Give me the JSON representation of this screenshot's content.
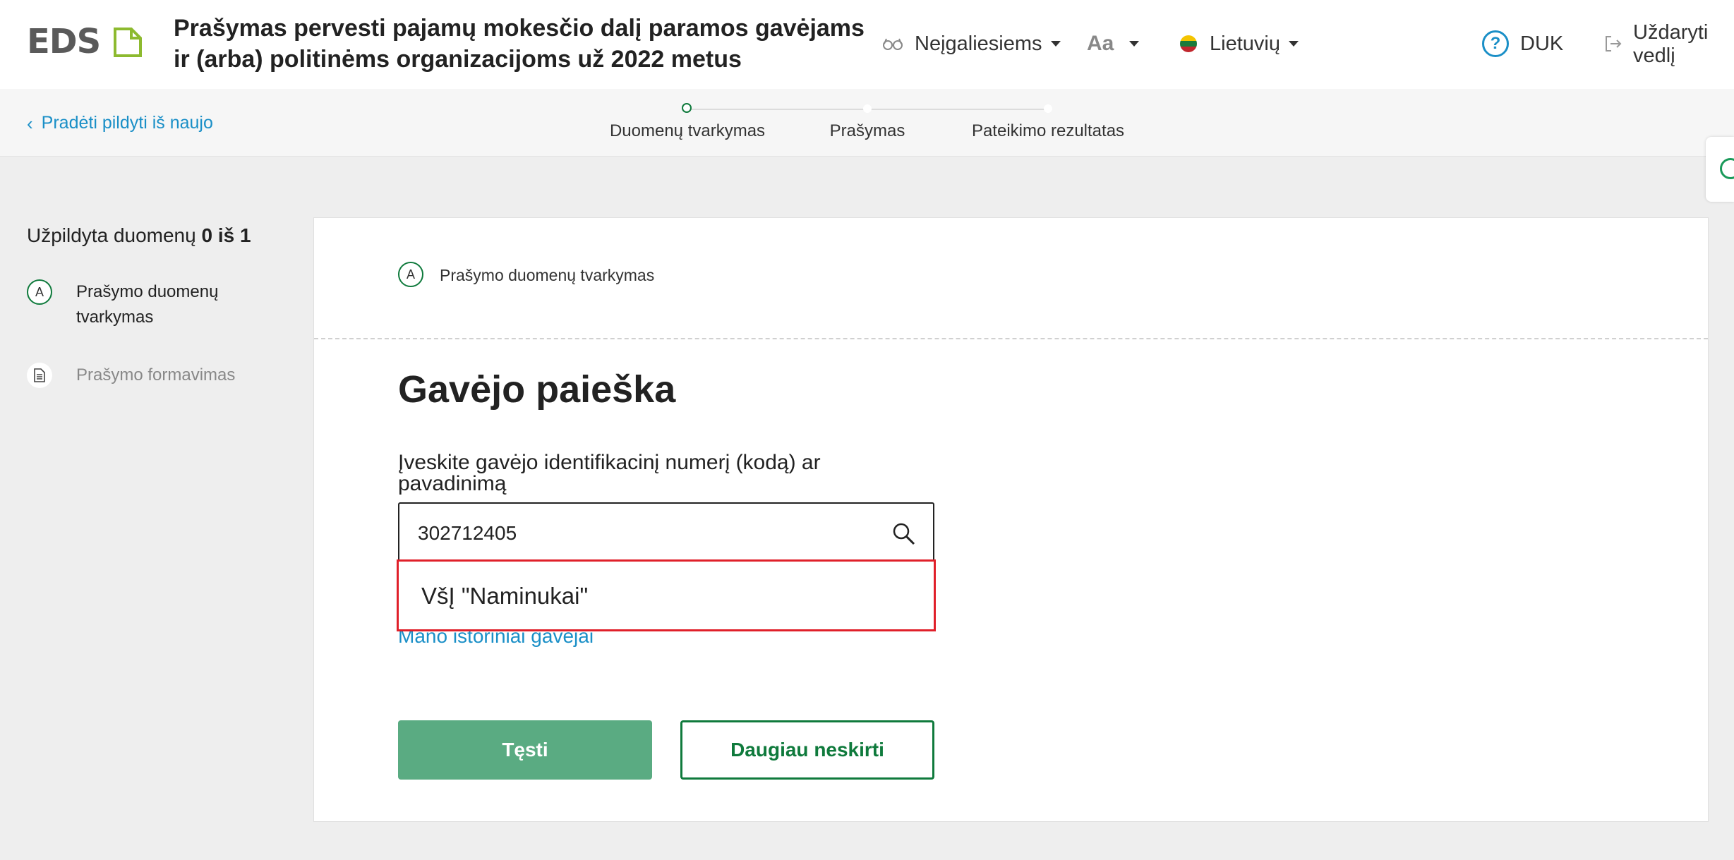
{
  "header": {
    "logo": "EDS",
    "title": "Prašymas pervesti pajamų mokesčio dalį paramos gavėjams ir (arba) politinėms organizacijoms už 2022 metus",
    "accessibility_label": "Neįgaliesiems",
    "font_size_label": "Aa",
    "language_label": "Lietuvių",
    "faq_label": "DUK",
    "close_label": "Uždaryti vedlį"
  },
  "stepbar": {
    "back_label": "Pradėti pildyti iš naujo",
    "steps": [
      {
        "label": "Duomenų tvarkymas",
        "active": true
      },
      {
        "label": "Prašymas",
        "active": false
      },
      {
        "label": "Pateikimo rezultatas",
        "active": false
      }
    ]
  },
  "progress": {
    "title_prefix": "Užpildyta duomenų",
    "count": "0 iš 1",
    "sections": [
      {
        "badge": "A",
        "label": "Prašymo duomenų tvarkymas"
      },
      {
        "label": "Prašymo formavimas"
      }
    ]
  },
  "card": {
    "section_badge": "A",
    "section_label": "Prašymo duomenų tvarkymas",
    "heading": "Gavėjo paieška",
    "field_label": "Įveskite gavėjo identifikacinį numerį (kodą) ar pavadinimą",
    "search_value": "302712405",
    "history_link": "Mano istoriniai gavėjai",
    "suggestion": "VšĮ \"Naminukai\"",
    "continue_label": "Tęsti",
    "no_more_label": "Daugiau neskirti"
  },
  "colors": {
    "brand_green": "#0f7a3c",
    "button_green": "#5aab82",
    "link_blue": "#1a8fc7",
    "highlight_red": "#e0202a"
  }
}
